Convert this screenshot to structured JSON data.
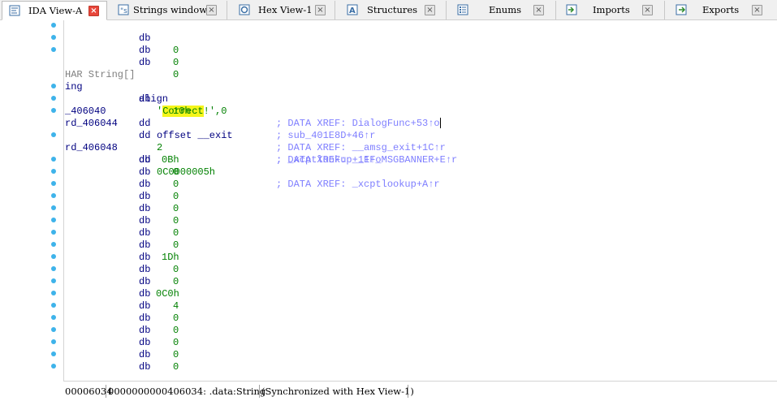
{
  "tabs": [
    {
      "label": "IDA View-A",
      "icon": "ida-view-icon",
      "active": true
    },
    {
      "label": "Strings window",
      "icon": "strings-window-icon",
      "active": false
    },
    {
      "label": "Hex View-1",
      "icon": "hex-view-icon",
      "active": false
    },
    {
      "label": "Structures",
      "icon": "structures-icon",
      "active": false
    },
    {
      "label": "Enums",
      "icon": "enums-icon",
      "active": false
    },
    {
      "label": "Imports",
      "icon": "imports-icon",
      "active": false
    },
    {
      "label": "Exports",
      "icon": "exports-icon",
      "active": false
    }
  ],
  "close_glyph": "×",
  "listing": {
    "header": "HAR String[]",
    "l1_label": "ing",
    "l1_mnemonic": "db",
    "l1_string": "'Correct!'",
    "l1_tail": ",0",
    "l1_comment": "; DATA XREF: DialogFunc+53↑o",
    "l2_mnemonic": "align",
    "l2_operand": "10h",
    "l3_label": "_406040",
    "l3_mnemonic": "dd",
    "l3_operand": "offset __exit",
    "l3_comment": "; DATA XREF: __amsg_exit+1C↑r",
    "l4_label": "rd_406044",
    "l4_mnemonic": "dd",
    "l4_operand": "2",
    "l4_comment": "; DATA XREF: __FF_MSGBANNER+E↑r",
    "l5_comment": "; sub_401E8D+46↑r",
    "l6_label": "rd_406048",
    "l6_mnemonic": "dd",
    "l6_operand": "0C0000005h",
    "l6_comment": "; DATA XREF: _xcptlookup+A↑r",
    "l7_comment": "; _xcptlookup+11↑o",
    "db_top": [
      {
        "mnemonic": "db",
        "value": "0"
      },
      {
        "mnemonic": "db",
        "value": "0"
      },
      {
        "mnemonic": "db",
        "value": "0"
      }
    ],
    "db_bottom": [
      {
        "mnemonic": "db",
        "value": "0Bh"
      },
      {
        "mnemonic": "db",
        "value": "0"
      },
      {
        "mnemonic": "db",
        "value": "0"
      },
      {
        "mnemonic": "db",
        "value": "0"
      },
      {
        "mnemonic": "db",
        "value": "0"
      },
      {
        "mnemonic": "db",
        "value": "0"
      },
      {
        "mnemonic": "db",
        "value": "0"
      },
      {
        "mnemonic": "db",
        "value": "0"
      },
      {
        "mnemonic": "db",
        "value": "1Dh"
      },
      {
        "mnemonic": "db",
        "value": "0"
      },
      {
        "mnemonic": "db",
        "value": "0"
      },
      {
        "mnemonic": "db",
        "value": "0C0h"
      },
      {
        "mnemonic": "db",
        "value": "4"
      },
      {
        "mnemonic": "db",
        "value": "0"
      },
      {
        "mnemonic": "db",
        "value": "0"
      },
      {
        "mnemonic": "db",
        "value": "0"
      },
      {
        "mnemonic": "db",
        "value": "0"
      },
      {
        "mnemonic": "db",
        "value": "0"
      }
    ]
  },
  "status": {
    "file_offset": "00006034",
    "location": "0000000000406034: .data:String",
    "sync": "(Synchronized with Hex View-1)"
  },
  "colors": {
    "dot": "#3eb3ea",
    "highlight": "#f5f51a",
    "comment": "#7f7fff",
    "operand": "#008000",
    "label": "#000080",
    "active_close": "#e8463b"
  }
}
